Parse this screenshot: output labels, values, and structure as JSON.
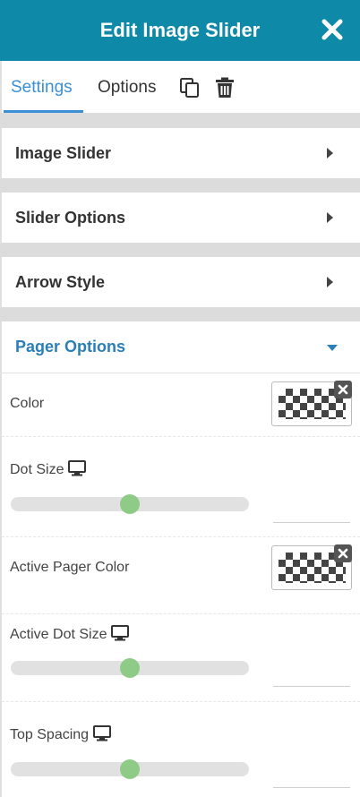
{
  "header": {
    "title": "Edit Image Slider"
  },
  "tabs": {
    "settings": "Settings",
    "options": "Options"
  },
  "sections": [
    {
      "label": "Image Slider",
      "expanded": false
    },
    {
      "label": "Slider Options",
      "expanded": false
    },
    {
      "label": "Arrow Style",
      "expanded": false
    },
    {
      "label": "Pager Options",
      "expanded": true
    }
  ],
  "pager_options": {
    "color": {
      "label": "Color",
      "value": "transparent"
    },
    "dot_size": {
      "label": "Dot Size",
      "slider_level": 0.5,
      "value": ""
    },
    "active_pager_color": {
      "label": "Active Pager Color",
      "value": "transparent"
    },
    "active_dot_size": {
      "label": "Active Dot Size",
      "slider_level": 0.5,
      "value": ""
    },
    "top_spacing": {
      "label": "Top Spacing",
      "slider_level": 0.5,
      "value": ""
    }
  },
  "colors": {
    "header_bg": "#0e89a8",
    "active_tab": "#3a8fd6",
    "active_section": "#2a7fb8",
    "slider_thumb": "#8dcb86",
    "slider_track": "#e1e1e1"
  },
  "icons": {
    "close": "close-icon",
    "copy": "copy-icon",
    "delete": "trash-icon",
    "device": "monitor-icon",
    "collapsed": "caret-right-icon",
    "expanded": "caret-down-icon",
    "clear_color": "clear-color-icon"
  }
}
